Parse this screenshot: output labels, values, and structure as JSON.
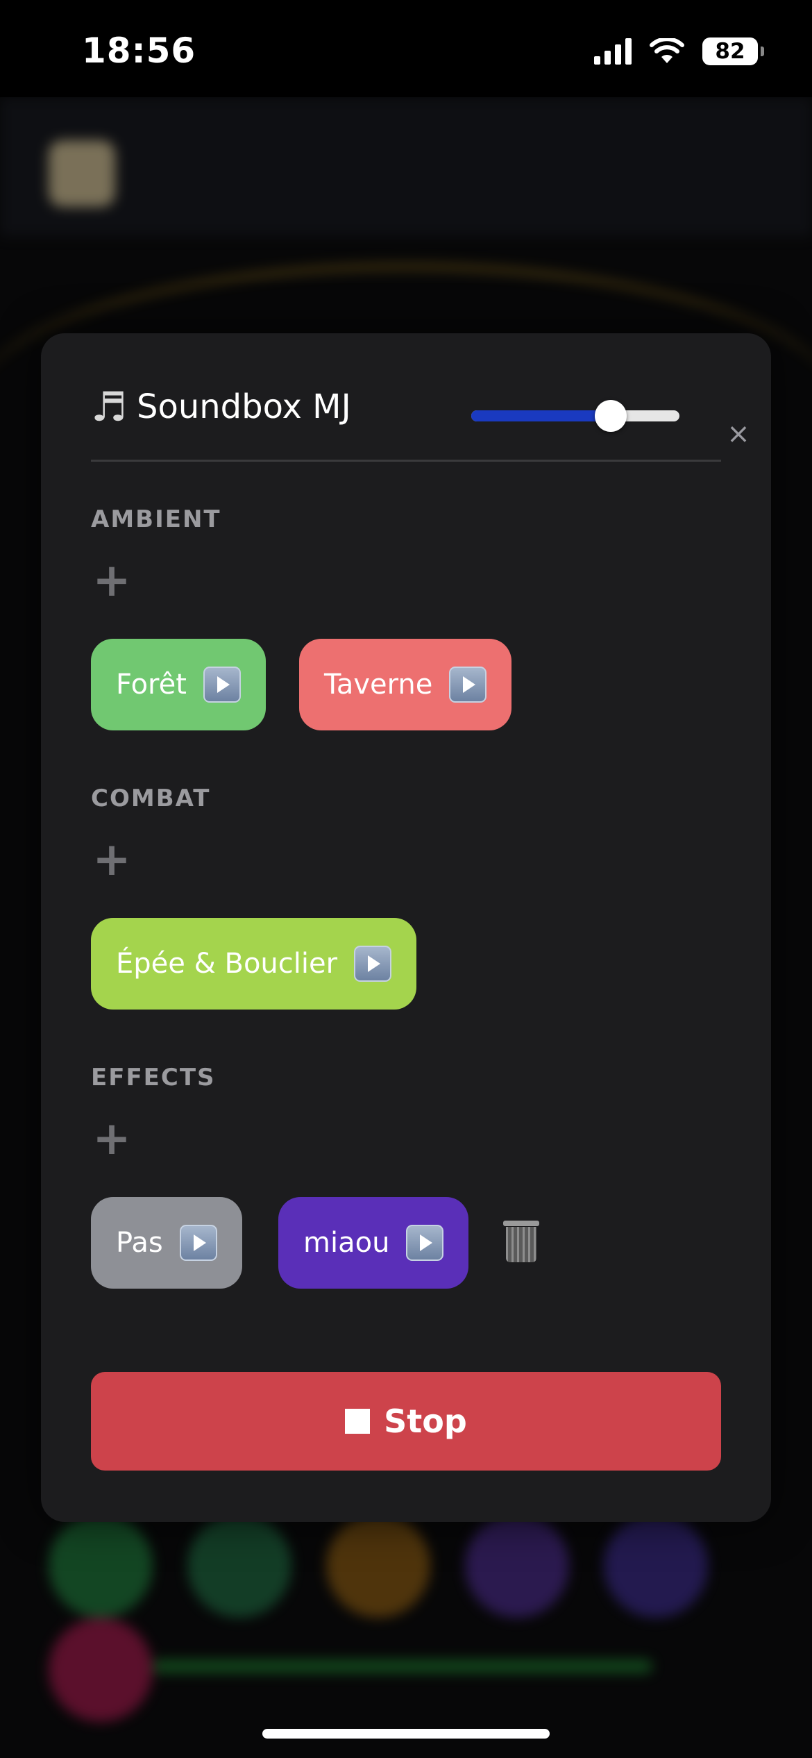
{
  "status_bar": {
    "time": "18:56",
    "battery": "82"
  },
  "modal": {
    "title": "Soundbox MJ",
    "title_icon": "music-note-icon",
    "volume": 0.67,
    "close_label": "×",
    "sections": [
      {
        "label": "AMBIENT",
        "add_label": "+",
        "sounds": [
          {
            "label": "Forêt",
            "color": "#71c871"
          },
          {
            "label": "Taverne",
            "color": "#ed7070"
          }
        ]
      },
      {
        "label": "COMBAT",
        "add_label": "+",
        "sounds": [
          {
            "label": "Épée & Bouclier",
            "color": "#a4d44d"
          }
        ]
      },
      {
        "label": "EFFECTS",
        "add_label": "+",
        "sounds": [
          {
            "label": "Pas",
            "color": "#8e9096"
          },
          {
            "label": "miaou",
            "color": "#5a2fb8"
          }
        ]
      }
    ],
    "stop_label": "Stop"
  },
  "colors": {
    "accent": "#1a3ac0",
    "stop": "#cd434b",
    "modal_bg": "#1c1c1e"
  }
}
